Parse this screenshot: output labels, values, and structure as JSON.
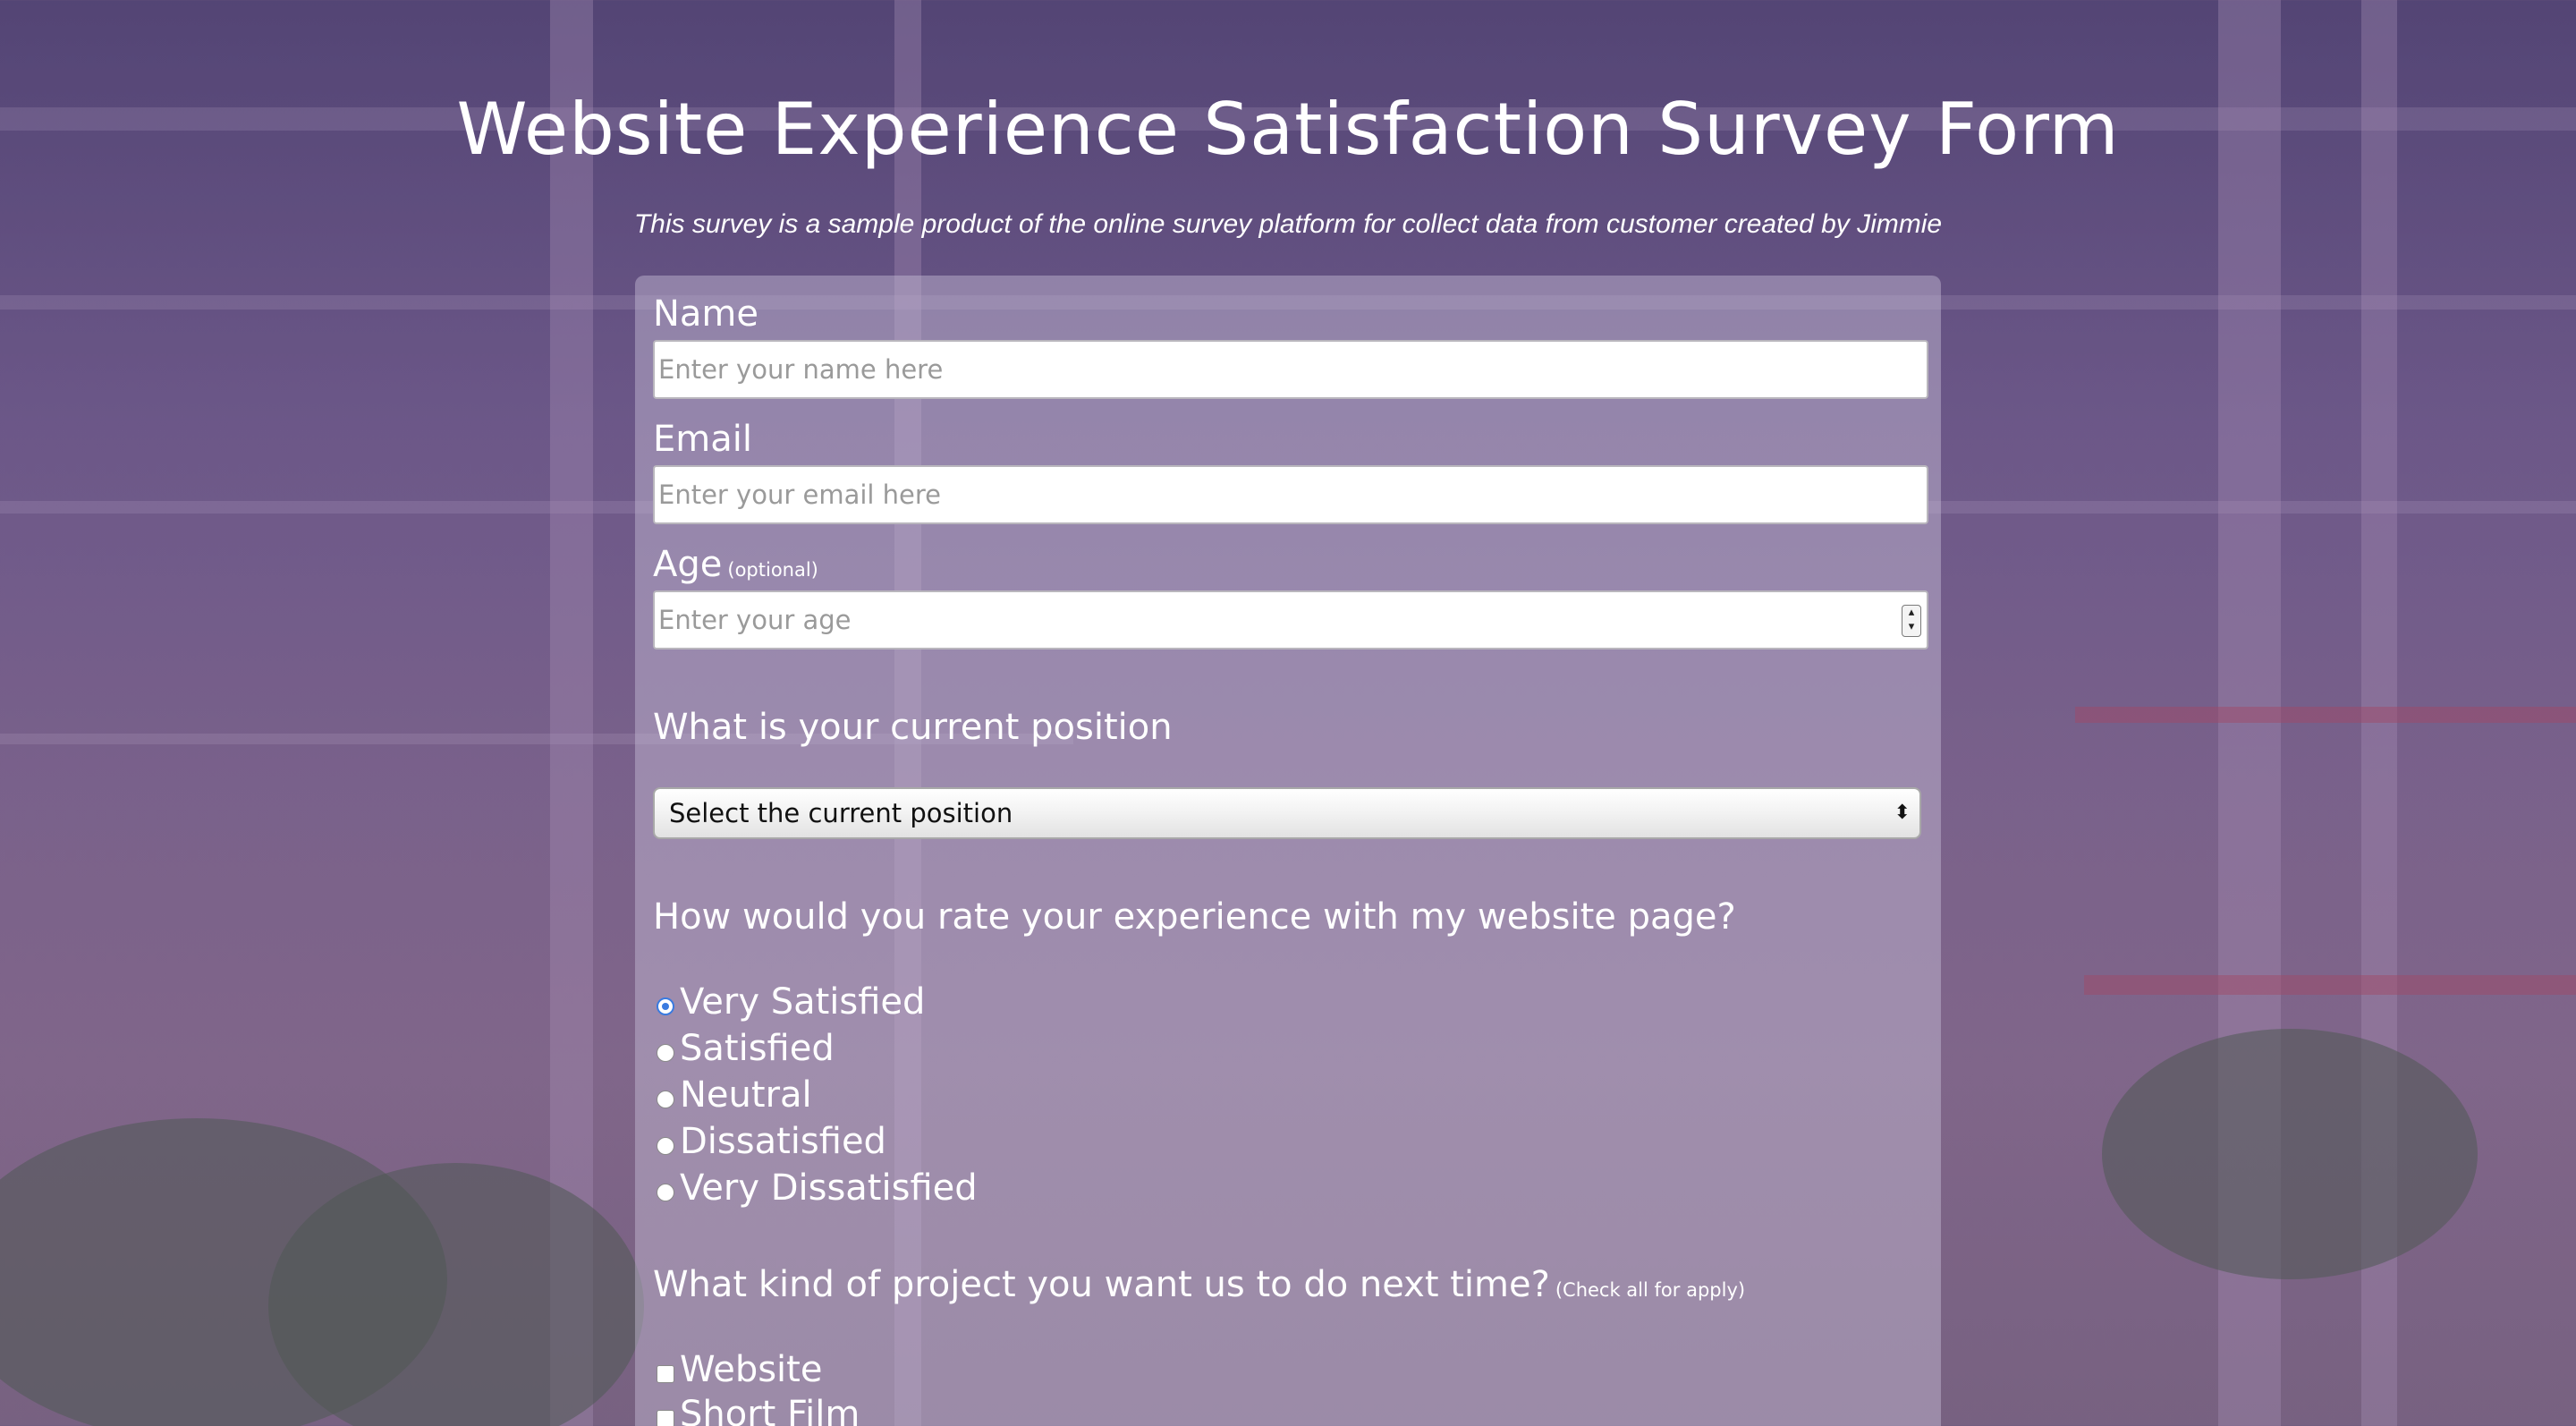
{
  "header": {
    "title": "Website Experience Satisfaction Survey Form",
    "subtitle": "This survey is a sample product of the online survey platform for collect data from customer created by Jimmie"
  },
  "form": {
    "name": {
      "label": "Name",
      "placeholder": "Enter your name here"
    },
    "email": {
      "label": "Email",
      "placeholder": "Enter your email here"
    },
    "age": {
      "label": "Age",
      "hint": "(optional)",
      "placeholder": "Enter your age"
    },
    "position": {
      "question": "What is your current position",
      "selected": "Select the current position"
    },
    "rating": {
      "question": "How would you rate your experience with my website page?",
      "options": [
        {
          "label": "Very Satisfied",
          "checked": true
        },
        {
          "label": "Satisfied",
          "checked": false
        },
        {
          "label": "Neutral",
          "checked": false
        },
        {
          "label": "Dissatisfied",
          "checked": false
        },
        {
          "label": "Very Dissatisfied",
          "checked": false
        }
      ]
    },
    "projects": {
      "question": "What kind of project you want us to do next time?",
      "hint": "(Check all for apply)",
      "options": [
        {
          "label": "Website",
          "checked": false
        },
        {
          "label": "Short Film",
          "checked": false
        }
      ]
    }
  },
  "colors": {
    "radio_accent": "#3a7be0",
    "text": "#ffffff",
    "card": "#c8bed7"
  }
}
